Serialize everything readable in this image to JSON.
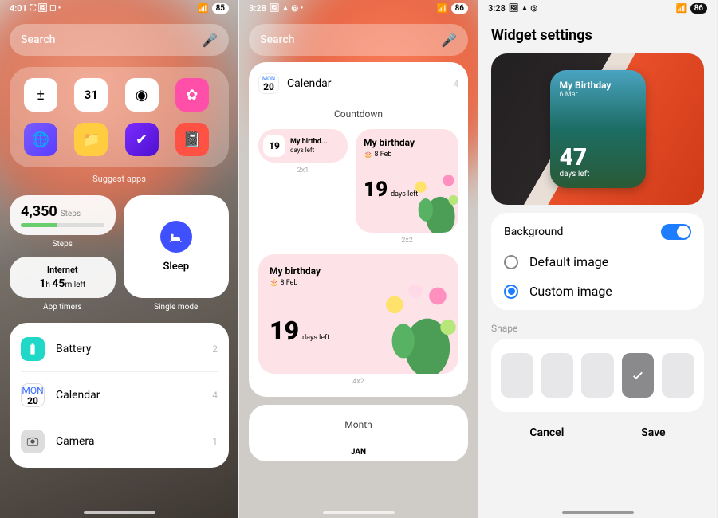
{
  "phone1": {
    "status": {
      "time": "4:01",
      "icons": "⛶ 🖼 ⬚ •",
      "battery": "85"
    },
    "search": {
      "placeholder": "Search"
    },
    "folder": {
      "label": "Suggest apps",
      "apps": {
        "calc": "±",
        "cal": "31",
        "camera": "◉",
        "flower": "✿",
        "browser": "🌐",
        "files": "📁",
        "check": "✔",
        "notes": "📓"
      }
    },
    "steps": {
      "value": "4,350",
      "unit": "Steps",
      "label": "Steps"
    },
    "sleep": {
      "label": "Sleep"
    },
    "internet": {
      "title": "Internet",
      "hours": "1",
      "mins": "45",
      "left": "left"
    },
    "apptimers": {
      "label": "App timers"
    },
    "singlemode": {
      "label": "Single mode"
    },
    "list": [
      {
        "name": "Battery",
        "count": "2"
      },
      {
        "name": "Calendar",
        "count": "4"
      },
      {
        "name": "Camera",
        "count": "1"
      }
    ],
    "cal_icon": {
      "mon": "MON",
      "day": "20"
    }
  },
  "phone2": {
    "status": {
      "time": "3:28",
      "icons": "🖼 ▲ ◎ •",
      "battery": "86"
    },
    "search": {
      "placeholder": "Search"
    },
    "header": {
      "mon": "MON",
      "day": "20",
      "title": "Calendar",
      "count": "4"
    },
    "section1": "Countdown",
    "widget_title": "My birthday",
    "widget_title_short": "My birthd...",
    "widget_date": "8 Feb",
    "widget_days": "19",
    "widget_small_day": "19",
    "days_left": "days left",
    "size_2x1": "2x1",
    "size_2x2": "2x2",
    "size_4x2": "4x2",
    "section2": "Month",
    "jan": "JAN"
  },
  "phone3": {
    "status": {
      "time": "3:28",
      "icons": "🖼 ▲ ◎",
      "battery": "86"
    },
    "title": "Widget settings",
    "preview": {
      "title": "My Birthday",
      "date": "6 Mar",
      "days": "47",
      "days_left": "days left"
    },
    "background": {
      "label": "Background",
      "opt_default": "Default image",
      "opt_custom": "Custom image",
      "selected": "custom"
    },
    "shape_label": "Shape",
    "actions": {
      "cancel": "Cancel",
      "save": "Save"
    }
  }
}
